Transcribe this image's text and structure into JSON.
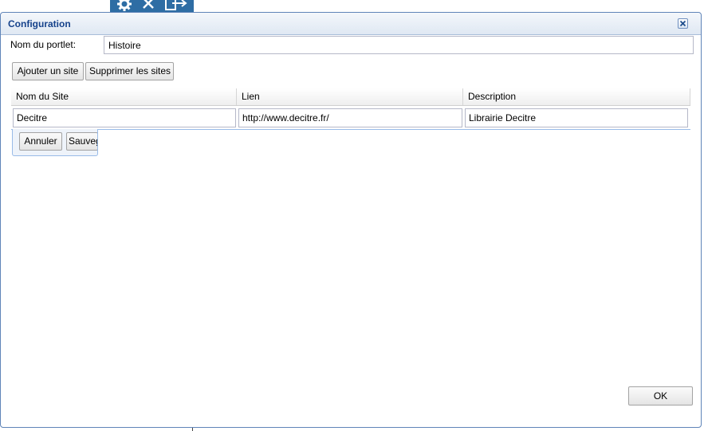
{
  "topbar": {
    "icons": [
      "gear-icon",
      "close-icon",
      "exit-icon"
    ]
  },
  "dialog": {
    "title": "Configuration",
    "close_icon": "close-icon"
  },
  "form": {
    "portlet_label": "Nom du portlet:",
    "portlet_value": "Histoire",
    "add_site_label": "Ajouter un site",
    "remove_sites_label": "Supprimer les sites"
  },
  "grid": {
    "columns": [
      "Nom du Site",
      "Lien",
      "Description"
    ],
    "rows": [
      {
        "name": "Decitre",
        "link": "http://www.decitre.fr/",
        "description": "Librairie Decitre"
      }
    ],
    "editor": {
      "cancel_label": "Annuler",
      "save_label": "Sauvegarder"
    }
  },
  "footer": {
    "ok_label": "OK"
  },
  "colors": {
    "accent": "#2e6da4",
    "title": "#15428b",
    "border": "#5f84b8"
  }
}
